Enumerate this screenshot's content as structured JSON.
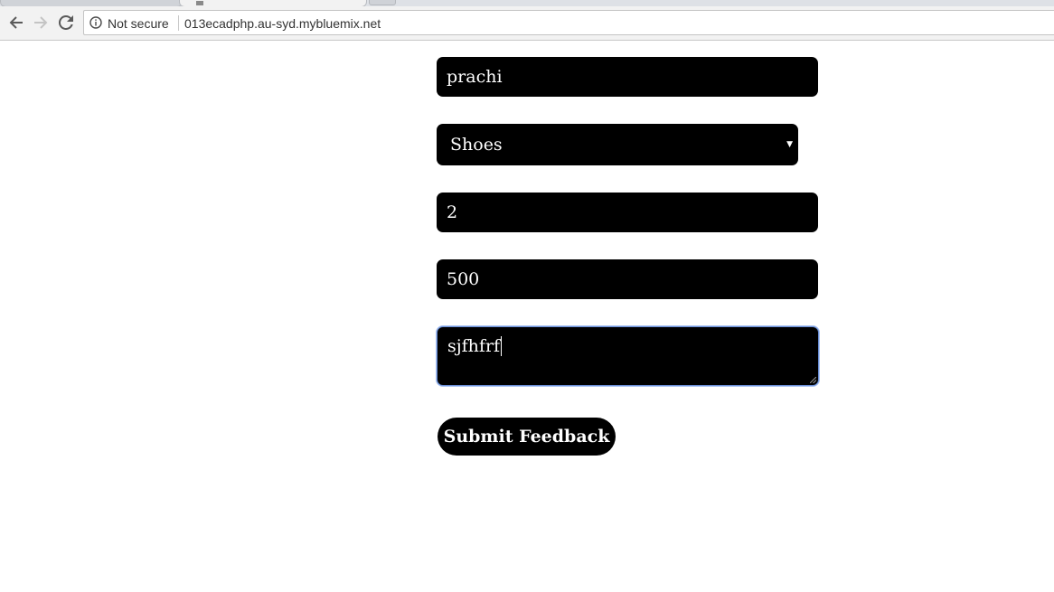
{
  "browser": {
    "security_label": "Not secure",
    "url": "013ecadphp.au-syd.mybluemix.net"
  },
  "form": {
    "name_value": "prachi",
    "category_selected": "Shoes",
    "quantity_value": "2",
    "price_value": "500",
    "feedback_value": "sjfhfrf",
    "submit_label": "Submit Feedback"
  }
}
